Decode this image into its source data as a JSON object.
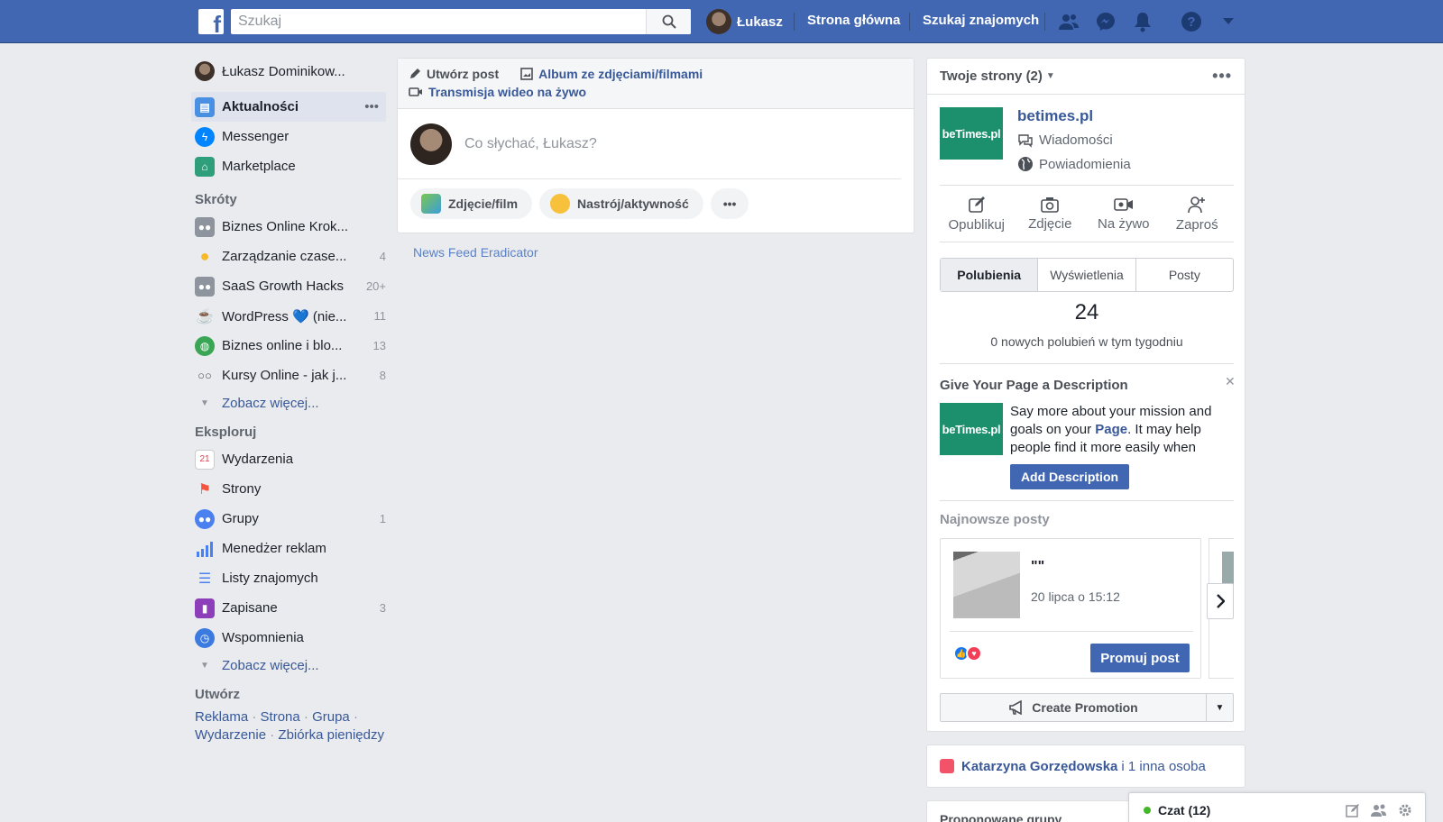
{
  "topbar": {
    "logo": "f",
    "search_placeholder": "Szukaj",
    "user_name": "Łukasz",
    "links": [
      "Strona główna",
      "Szukaj znajomych"
    ],
    "icons": [
      "friends-icon",
      "messenger-icon",
      "notifications-icon",
      "help-icon",
      "account-menu-icon"
    ]
  },
  "left": {
    "user": "Łukasz Dominikow...",
    "main_items": [
      {
        "label": "Aktualności",
        "active": true,
        "more": "•••"
      },
      {
        "label": "Messenger"
      },
      {
        "label": "Marketplace"
      }
    ],
    "shortcuts_title": "Skróty",
    "shortcuts": [
      {
        "label": "Biznes Online Krok...",
        "count": ""
      },
      {
        "label": "Zarządzanie czase...",
        "count": "4"
      },
      {
        "label": "SaaS Growth Hacks",
        "count": "20+"
      },
      {
        "label": "WordPress 💙 (nie...",
        "count": "11"
      },
      {
        "label": "Biznes online i blo...",
        "count": "13"
      },
      {
        "label": "Kursy Online - jak j...",
        "count": "8"
      }
    ],
    "see_more": "Zobacz więcej...",
    "explore_title": "Eksploruj",
    "explore": [
      {
        "label": "Wydarzenia",
        "count": ""
      },
      {
        "label": "Strony",
        "count": ""
      },
      {
        "label": "Grupy",
        "count": "1"
      },
      {
        "label": "Menedżer reklam",
        "count": ""
      },
      {
        "label": "Listy znajomych",
        "count": ""
      },
      {
        "label": "Zapisane",
        "count": "3"
      },
      {
        "label": "Wspomnienia",
        "count": ""
      }
    ],
    "see_more2": "Zobacz więcej...",
    "create_title": "Utwórz",
    "create_links": [
      "Reklama",
      "Strona",
      "Grupa",
      "Wydarzenie",
      "Zbiórka pieniędzy"
    ]
  },
  "composer": {
    "create_post": "Utwórz post",
    "album": "Album ze zdjęciami/filmami",
    "live": "Transmisja wideo na żywo",
    "placeholder": "Co słychać, Łukasz?",
    "photo": "Zdjęcie/film",
    "mood": "Nastrój/aktywność",
    "more": "•••"
  },
  "news_feed_eradicator": "News Feed Eradicator",
  "pages": {
    "title": "Twoje strony (2)",
    "page_name": "betimes.pl",
    "logo_text": "beTimes.pl",
    "messages": "Wiadomości",
    "notifications": "Powiadomienia",
    "actions": [
      "Opublikuj",
      "Zdjęcie",
      "Na żywo",
      "Zaproś"
    ],
    "tabs": [
      "Polubienia",
      "Wyświetlenia",
      "Posty"
    ],
    "likes": "24",
    "likes_sub": "0 nowych polubień w tym tygodniu",
    "desc_title": "Give Your Page a Description",
    "desc_text_1": "Say more about your mission and goals on your ",
    "desc_text_page": "Page",
    "desc_text_2": ". It may help people find it more easily when",
    "add_desc": "Add Description",
    "latest_title": "Najnowsze posty",
    "post_quote": "\"\"",
    "post_date": "20 lipca o 15:12",
    "promote": "Promuj post",
    "create_promotion": "Create Promotion"
  },
  "birthday": {
    "name": "Katarzyna Gorzędowska",
    "rest": "i 1 inna osoba"
  },
  "suggested": "Proponowane grupy",
  "chat": {
    "label": "Czat (12)"
  },
  "colors": {
    "brand": "#4267b2",
    "link": "#385898",
    "page_logo": "#1c8f6d"
  }
}
